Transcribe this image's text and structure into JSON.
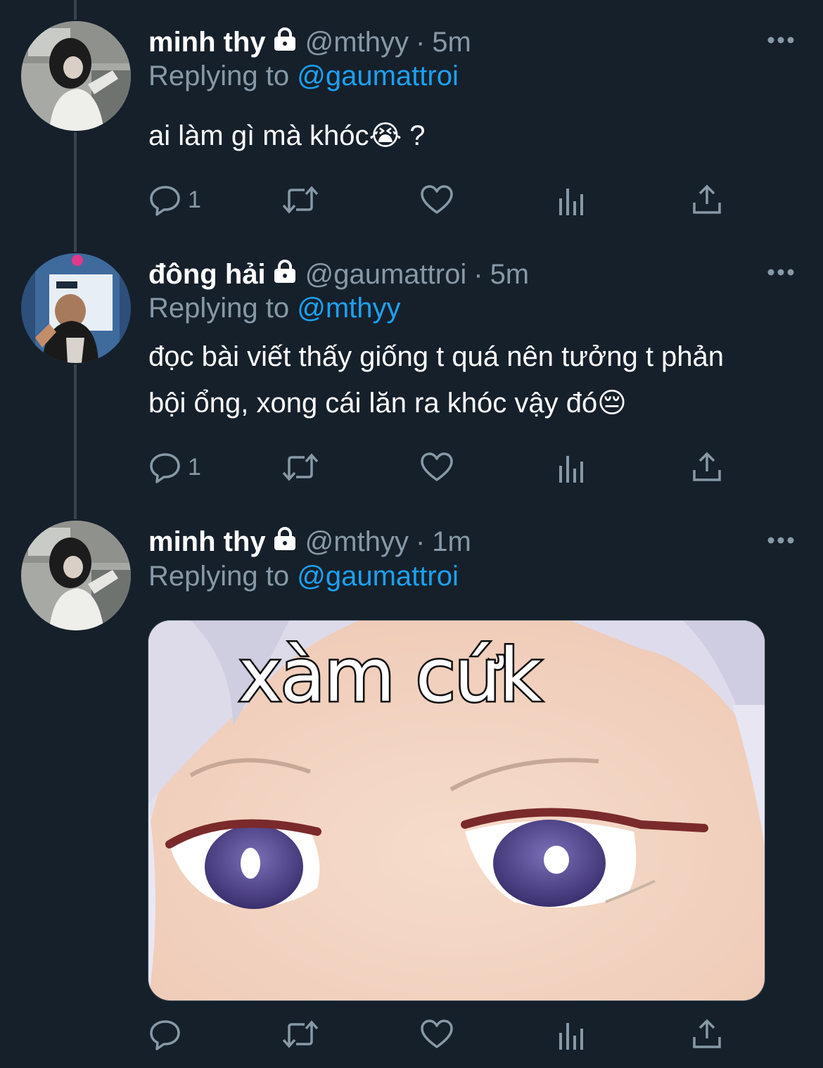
{
  "tweets": [
    {
      "name": "minh thy",
      "handle": "@mthyy",
      "time": "5m",
      "replying_prefix": "Replying to ",
      "replying_to": "@gaumattroi",
      "text_lines": [
        "ai làm gì mà khóc😭 ?"
      ],
      "reply_count": "1"
    },
    {
      "name": "đông hải",
      "handle": "@gaumattroi",
      "time": "5m",
      "replying_prefix": "Replying to ",
      "replying_to": "@mthyy",
      "text_lines": [
        "đọc bài viết thấy giống t quá nên tưởng t phản",
        "bội ổng, xong cái lăn ra khóc vậy đó😔"
      ],
      "reply_count": "1"
    },
    {
      "name": "minh thy",
      "handle": "@mthyy",
      "time": "1m",
      "replying_prefix": "Replying to ",
      "replying_to": "@gaumattroi",
      "media_caption": "xàm cứk",
      "reply_count": ""
    }
  ],
  "separator": "·",
  "icons": {
    "lock": "lock-icon",
    "more": "more-icon",
    "reply": "reply-icon",
    "retweet": "retweet-icon",
    "like": "heart-icon",
    "analytics": "analytics-icon",
    "share": "share-icon"
  },
  "colors": {
    "background": "#15202b",
    "secondary_text": "#8899a6",
    "link": "#1da1f2",
    "thread_line": "#38444d"
  }
}
